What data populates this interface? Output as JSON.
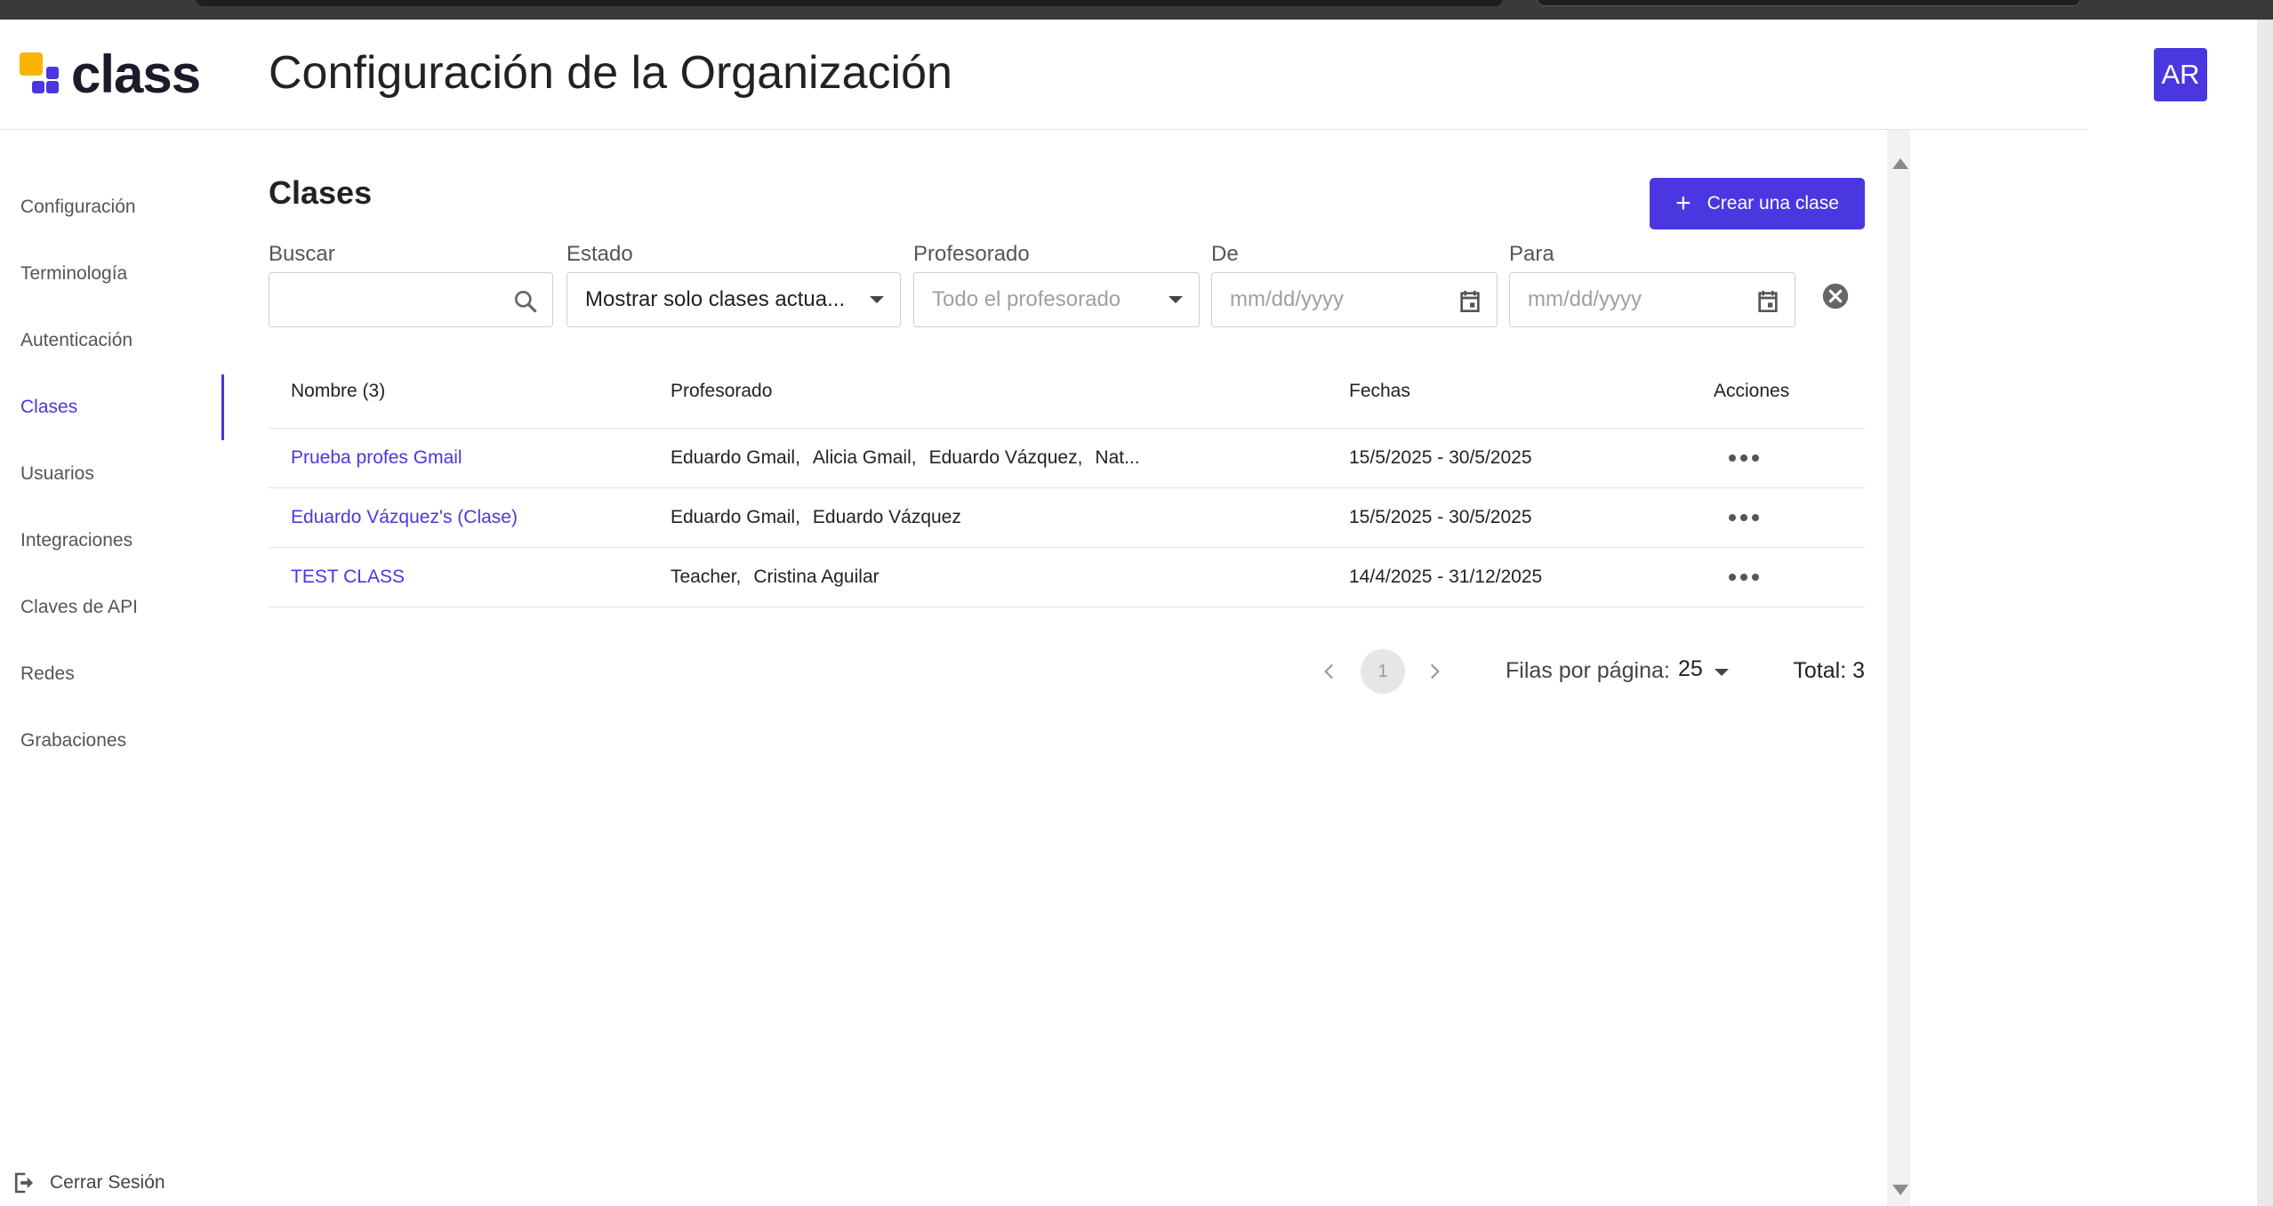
{
  "app": {
    "logo_text": "class",
    "page_title": "Configuración de la Organización",
    "avatar_initials": "AR"
  },
  "sidebar": {
    "items": [
      {
        "label": "Configuración"
      },
      {
        "label": "Terminología"
      },
      {
        "label": "Autenticación"
      },
      {
        "label": "Clases",
        "active": true
      },
      {
        "label": "Usuarios"
      },
      {
        "label": "Integraciones"
      },
      {
        "label": "Claves de API"
      },
      {
        "label": "Redes"
      },
      {
        "label": "Grabaciones"
      }
    ],
    "logout_label": "Cerrar Sesión"
  },
  "main": {
    "section_title": "Clases",
    "create_button_label": "Crear una clase",
    "filters": {
      "search": {
        "label": "Buscar",
        "value": ""
      },
      "status": {
        "label": "Estado",
        "value": "Mostrar solo clases actua..."
      },
      "teachers": {
        "label": "Profesorado",
        "placeholder": "Todo el profesorado"
      },
      "from": {
        "label": "De",
        "placeholder": "mm/dd/yyyy"
      },
      "to": {
        "label": "Para",
        "placeholder": "mm/dd/yyyy"
      }
    },
    "table": {
      "headers": [
        "Nombre (3)",
        "Profesorado",
        "Fechas",
        "Acciones"
      ],
      "rows": [
        {
          "name": "Prueba profes Gmail",
          "teachers": [
            "Eduardo Gmail,",
            "Alicia Gmail,",
            "Eduardo Vázquez,",
            "Nat..."
          ],
          "dates": "15/5/2025 - 30/5/2025"
        },
        {
          "name": "Eduardo Vázquez's (Clase)",
          "teachers": [
            "Eduardo Gmail,",
            "Eduardo Vázquez"
          ],
          "dates": "15/5/2025 - 30/5/2025"
        },
        {
          "name": "TEST CLASS",
          "teachers": [
            "Teacher,",
            "Cristina Aguilar"
          ],
          "dates": "14/4/2025 - 31/12/2025"
        }
      ]
    },
    "pagination": {
      "current_page": "1",
      "rows_per_page_label": "Filas por página:",
      "rows_per_page": "25",
      "total_label": "Total: 3"
    }
  },
  "colors": {
    "accent": "#4a37e0",
    "logo_yellow": "#f8b400"
  },
  "icons": [
    "search-icon",
    "calendar-icon",
    "clear-icon",
    "plus-icon",
    "more-icon",
    "chevron-left-icon",
    "chevron-right-icon",
    "logout-icon"
  ]
}
